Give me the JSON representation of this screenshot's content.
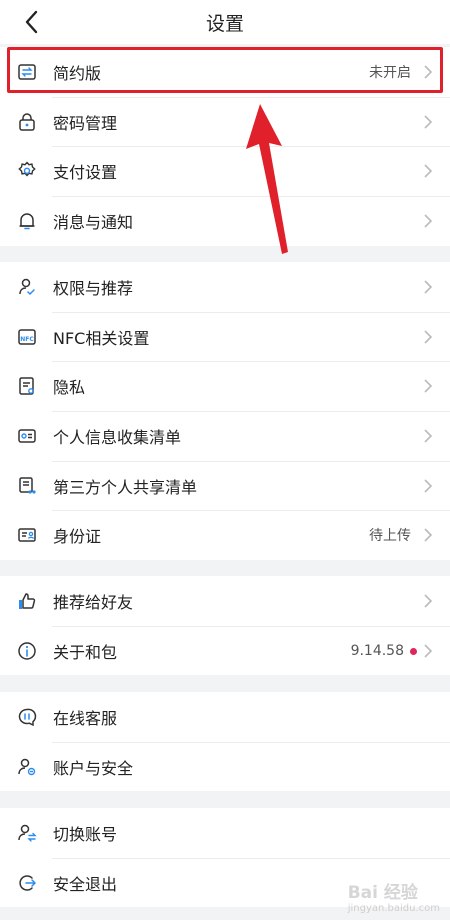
{
  "header": {
    "title": "设置"
  },
  "groups": [
    {
      "items": [
        {
          "label": "简约版",
          "value": "未开启",
          "icon": "simple-mode-icon"
        },
        {
          "label": "密码管理",
          "icon": "lock-icon"
        },
        {
          "label": "支付设置",
          "icon": "gear-icon"
        },
        {
          "label": "消息与通知",
          "icon": "bell-icon"
        }
      ]
    },
    {
      "items": [
        {
          "label": "权限与推荐",
          "icon": "permission-icon"
        },
        {
          "label": "NFC相关设置",
          "icon": "nfc-icon"
        },
        {
          "label": "隐私",
          "icon": "privacy-icon"
        },
        {
          "label": "个人信息收集清单",
          "icon": "id-card-icon"
        },
        {
          "label": "第三方个人共享清单",
          "icon": "share-list-icon"
        },
        {
          "label": "身份证",
          "value": "待上传",
          "icon": "identity-card-icon"
        }
      ]
    },
    {
      "items": [
        {
          "label": "推荐给好友",
          "icon": "thumbs-up-icon"
        },
        {
          "label": "关于和包",
          "value": "9.14.58",
          "icon": "info-icon"
        }
      ]
    },
    {
      "items": [
        {
          "label": "在线客服",
          "icon": "chat-icon"
        },
        {
          "label": "账户与安全",
          "icon": "user-shield-icon"
        }
      ]
    },
    {
      "items": [
        {
          "label": "切换账号",
          "icon": "switch-account-icon"
        },
        {
          "label": "安全退出",
          "icon": "logout-icon"
        }
      ]
    }
  ],
  "colors": {
    "highlight": "#e0202a",
    "badge": "#e0245e"
  },
  "watermark": {
    "brand": "Bai 经验",
    "url": "jingyan.baidu.com"
  }
}
